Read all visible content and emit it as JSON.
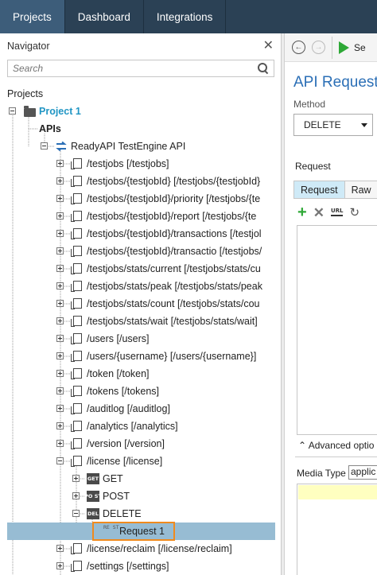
{
  "topnav": {
    "tabs": [
      {
        "label": "Projects",
        "active": true
      },
      {
        "label": "Dashboard",
        "active": false
      },
      {
        "label": "Integrations",
        "active": false
      }
    ]
  },
  "navigator": {
    "title": "Navigator",
    "search_placeholder": "Search",
    "projects_label": "Projects",
    "tree": [
      {
        "label": "Project 1",
        "kind": "project"
      },
      {
        "label": "APIs",
        "kind": "apis"
      },
      {
        "label": "ReadyAPI TestEngine API",
        "kind": "api"
      },
      {
        "label": "/testjobs [/testjobs]",
        "kind": "resource"
      },
      {
        "label": "/testjobs/{testjobId} [/testjobs/{testjobId}",
        "kind": "resource"
      },
      {
        "label": "/testjobs/{testjobId}/priority [/testjobs/{te",
        "kind": "resource"
      },
      {
        "label": "/testjobs/{testjobId}/report [/testjobs/{te",
        "kind": "resource"
      },
      {
        "label": "/testjobs/{testjobId}/transactions [/testjol",
        "kind": "resource"
      },
      {
        "label": "/testjobs/{testjobId}/transactio [/testjobs/",
        "kind": "resource"
      },
      {
        "label": "/testjobs/stats/current [/testjobs/stats/cu",
        "kind": "resource"
      },
      {
        "label": "/testjobs/stats/peak [/testjobs/stats/peak",
        "kind": "resource"
      },
      {
        "label": "/testjobs/stats/count [/testjobs/stats/cou",
        "kind": "resource"
      },
      {
        "label": "/testjobs/stats/wait [/testjobs/stats/wait]",
        "kind": "resource"
      },
      {
        "label": "/users [/users]",
        "kind": "resource"
      },
      {
        "label": "/users/{username} [/users/{username}]",
        "kind": "resource"
      },
      {
        "label": "/token [/token]",
        "kind": "resource"
      },
      {
        "label": "/tokens [/tokens]",
        "kind": "resource"
      },
      {
        "label": "/auditlog [/auditlog]",
        "kind": "resource"
      },
      {
        "label": "/analytics [/analytics]",
        "kind": "resource"
      },
      {
        "label": "/version [/version]",
        "kind": "resource"
      },
      {
        "label": "/license [/license]",
        "kind": "resource"
      },
      {
        "label": "GET",
        "kind": "method",
        "icon_text": "GET"
      },
      {
        "label": "POST",
        "kind": "method",
        "icon_text": "PO ST"
      },
      {
        "label": "DELETE",
        "kind": "method",
        "icon_text": "DEL"
      },
      {
        "label": "Request 1",
        "kind": "request",
        "icon_text": "RE ST"
      },
      {
        "label": "/license/reclaim [/license/reclaim]",
        "kind": "resource"
      },
      {
        "label": "/settings [/settings]",
        "kind": "resource"
      }
    ]
  },
  "editor": {
    "send_label": "Se",
    "title": "API Request",
    "method_label": "Method",
    "method_value": "DELETE",
    "request_label": "Request",
    "tabs": [
      "Request",
      "Raw"
    ],
    "advanced_label": "Advanced optio",
    "media_type_label": "Media Type",
    "media_type_value": "applic"
  },
  "colors": {
    "topnav_bg": "#2b4155",
    "topnav_active": "#3d5d7a",
    "project_text": "#2196c4",
    "selected_row": "#97bcd3",
    "highlight_border": "#f08a1d",
    "title_blue": "#2b6fb6",
    "play_green": "#2ea836"
  }
}
